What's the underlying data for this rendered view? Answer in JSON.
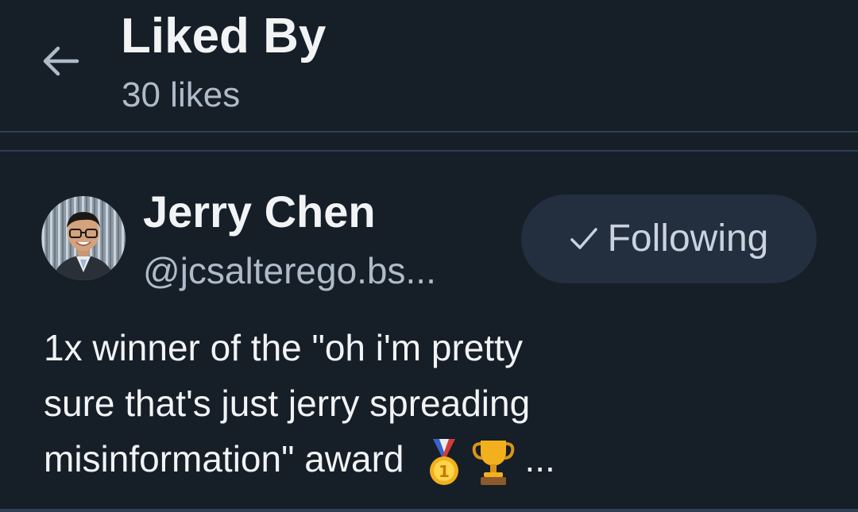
{
  "header": {
    "title": "Liked By",
    "subtitle": "30 likes",
    "back_icon": "arrow-left-icon"
  },
  "liker": {
    "name": "Jerry Chen",
    "handle": "@jcsalterego.bs...",
    "follow_label": "Following",
    "follow_icon": "check-icon",
    "bio_lines": [
      "1x winner of the \"oh i'm pretty",
      "sure that's just jerry spreading",
      "misinformation\" award"
    ],
    "bio_emojis": [
      "medal-icon",
      "trophy-icon"
    ],
    "bio_ellipsis": "..."
  },
  "colors": {
    "background": "#161e27",
    "divider": "#2e4052",
    "primary_text": "#f1f3f5",
    "secondary_text": "#aebbc9",
    "button_bg": "#232e3e"
  }
}
